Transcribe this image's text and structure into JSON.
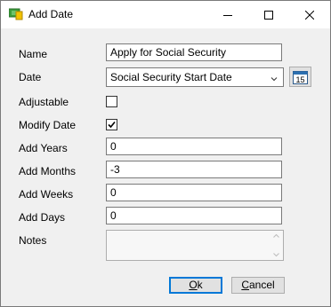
{
  "window": {
    "title": "Add Date",
    "icon": "money-calendar-icon",
    "controls": [
      "minimize-icon",
      "maximize-icon",
      "close-icon"
    ]
  },
  "form": {
    "name_label": "Name",
    "name_value": "Apply for Social Security",
    "date_label": "Date",
    "date_value": "Social Security Start Date",
    "calendar_button_text": "15",
    "adjustable_label": "Adjustable",
    "adjustable_checked": false,
    "modify_date_label": "Modify Date",
    "modify_date_checked": true,
    "add_years_label": "Add Years",
    "add_years_value": "0",
    "add_months_label": "Add Months",
    "add_months_value": "-3",
    "add_weeks_label": "Add Weeks",
    "add_weeks_value": "0",
    "add_days_label": "Add Days",
    "add_days_value": "0",
    "notes_label": "Notes",
    "notes_value": ""
  },
  "buttons": {
    "ok": {
      "first": "O",
      "rest": "k"
    },
    "cancel": {
      "first": "C",
      "rest": "ancel"
    }
  },
  "colors": {
    "dialog_bg": "#f0f0f0",
    "titlebar_bg": "#ffffff",
    "default_button_border": "#0078d7"
  }
}
